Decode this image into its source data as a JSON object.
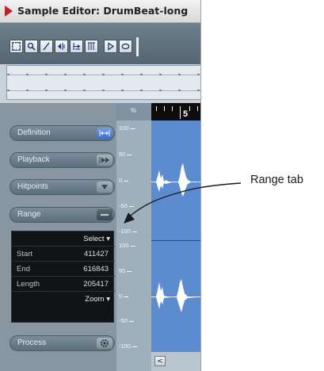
{
  "window": {
    "title": "Sample Editor: DrumBeat-long"
  },
  "toolbar": {
    "tools": [
      {
        "name": "range-selection-tool-icon",
        "glyph": "⬚"
      },
      {
        "name": "zoom-tool-icon",
        "glyph": "🔍"
      },
      {
        "name": "draw-tool-icon",
        "glyph": "✎"
      },
      {
        "name": "audition-tool-icon",
        "glyph": "◂|"
      },
      {
        "name": "scrub-tool-icon",
        "glyph": "⇋"
      },
      {
        "name": "time-warp-tool-icon",
        "glyph": "|||"
      },
      {
        "name": "play-button-icon",
        "glyph": "▷"
      },
      {
        "name": "loop-button-icon",
        "glyph": "⬭"
      }
    ]
  },
  "sections": {
    "definition": {
      "label": "Definition",
      "icon": "definition-icon"
    },
    "playback": {
      "label": "Playback",
      "icon": "playback-icon"
    },
    "hitpoints": {
      "label": "Hitpoints",
      "icon": "hitpoints-icon"
    },
    "range": {
      "label": "Range",
      "icon": "range-icon"
    },
    "process": {
      "label": "Process",
      "icon": "gear-icon"
    }
  },
  "range_info": {
    "select_label": "Select",
    "start_label": "Start",
    "start_value": "411427",
    "end_label": "End",
    "end_value": "616843",
    "length_label": "Length",
    "length_value": "205417",
    "zoom_label": "Zoom"
  },
  "ruler": {
    "unit": "%",
    "ticks_top": [
      "100",
      "50",
      "0",
      "-50",
      "-100"
    ],
    "ticks_bottom": [
      "100",
      "50",
      "0",
      "-50",
      "-100"
    ]
  },
  "timeline": {
    "bar_number": "5"
  },
  "scrollbar": {
    "left_arrow": "<"
  },
  "callout": {
    "text": "Range tab"
  },
  "colors": {
    "waveform_bg": "#5c8ccf",
    "active_button": "#3d6fc8",
    "brand": "#c0202a"
  }
}
